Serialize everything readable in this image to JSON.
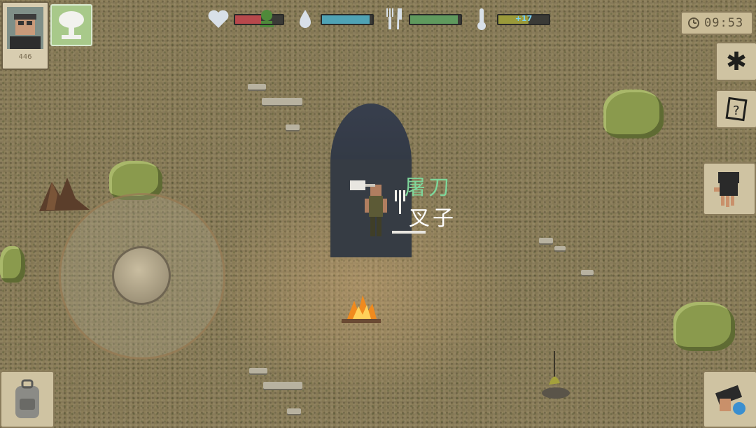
{
  "hud": {
    "health": {
      "icon": "heart-icon",
      "fill": 0.55,
      "color": "#b8484c"
    },
    "radiation": {
      "icon": "skull-radiation-icon"
    },
    "thirst": {
      "icon": "water-drop-icon",
      "fill": 0.95,
      "color": "#4fa3b5"
    },
    "hunger": {
      "icon": "fork-knife-icon",
      "fill": 0.95,
      "color": "#5f9a5e"
    },
    "temperature": {
      "icon": "thermometer-icon",
      "fill": 0.6,
      "color": "#9a9a3a",
      "value": "+17"
    },
    "clock": "09:53"
  },
  "player": {
    "score": "446"
  },
  "tent_labels": {
    "item1": "屠刀",
    "item2": "叉子"
  },
  "colors": {
    "ground": "#8a7d58",
    "item1": "#7ed69a",
    "item2": "#ffffff"
  }
}
